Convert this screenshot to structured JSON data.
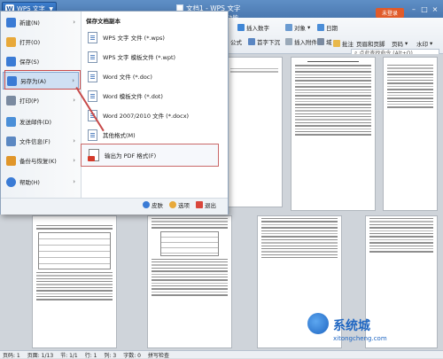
{
  "titlebar": {
    "app_button": "WPS 文字",
    "doc_title": "文档1 - WPS 文字",
    "signup": "未登录",
    "tab_partial": "功能"
  },
  "ribbon": {
    "row1": [
      "插入数字",
      "对象",
      "日期"
    ],
    "row2": [
      "公式",
      "首字下沉",
      "插入附件",
      "域"
    ],
    "right": [
      "批注",
      "页眉和页脚",
      "页码",
      "水印"
    ],
    "search_placeholder": "点此查找命令 (Alt+Q)"
  },
  "menu": {
    "left_items": [
      {
        "label": "新建(N)",
        "arrow": "›",
        "icon": "new-doc-icon",
        "color": "#3a7bd5"
      },
      {
        "label": "打开(O)",
        "arrow": "",
        "icon": "open-folder-icon",
        "color": "#e8a93a"
      },
      {
        "label": "保存(S)",
        "arrow": "",
        "icon": "save-icon",
        "color": "#3a7bd5"
      },
      {
        "label": "另存为(A)",
        "arrow": "›",
        "icon": "save-as-icon",
        "color": "#3a7bd5"
      },
      {
        "label": "打印(P)",
        "arrow": "›",
        "icon": "printer-icon",
        "color": "#7a8aa0"
      },
      {
        "label": "发送邮件(D)",
        "arrow": "",
        "icon": "mail-icon",
        "color": "#4a8fd8"
      },
      {
        "label": "文件信息(F)",
        "arrow": "›",
        "icon": "file-info-icon",
        "color": "#5b88c2"
      },
      {
        "label": "备份与恢复(K)",
        "arrow": "›",
        "icon": "backup-icon",
        "color": "#e0962a"
      },
      {
        "label": "帮助(H)",
        "arrow": "›",
        "icon": "help-icon",
        "color": "#3a7bd5"
      }
    ],
    "submenu_title": "保存文档副本",
    "sub_items": [
      "WPS 文字 文件 (*.wps)",
      "WPS 文字 模板文件 (*.wpt)",
      "Word 文件 (*.doc)",
      "Word 模板文件 (*.dot)",
      "Word 2007/2010 文件 (*.docx)",
      "其他格式(M)"
    ],
    "pdf_item": "输出为 PDF 格式(F)",
    "bottom": [
      "皮肤",
      "选项",
      "退出"
    ]
  },
  "statusbar": [
    "页码: 1",
    "页面: 1/13",
    "节: 1/1",
    "行: 1",
    "列: 3",
    "字数: 0",
    "拼写检查"
  ],
  "watermark": {
    "text": "系统城",
    "url": "xitongcheng.com"
  }
}
